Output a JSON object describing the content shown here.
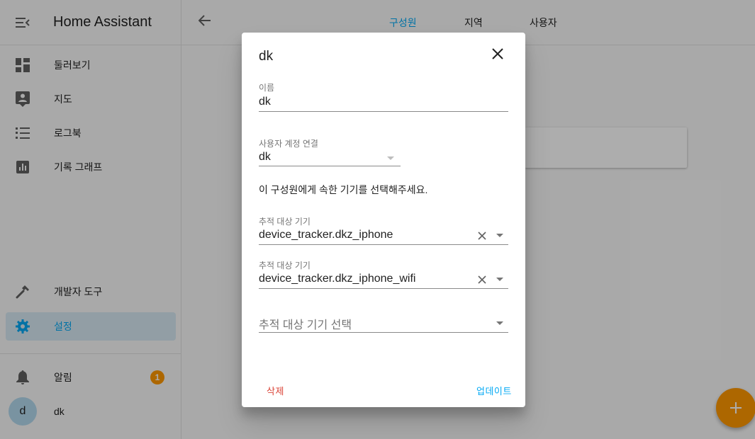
{
  "app": {
    "title": "Home Assistant"
  },
  "sidebar": {
    "items": [
      {
        "label": "둘러보기",
        "icon": "dashboard-icon"
      },
      {
        "label": "지도",
        "icon": "map-account-icon"
      },
      {
        "label": "로그북",
        "icon": "format-list-icon"
      },
      {
        "label": "기록 그래프",
        "icon": "chart-box-icon"
      },
      {
        "label": "개발자 도구",
        "icon": "hammer-icon"
      },
      {
        "label": "설정",
        "icon": "cog-icon",
        "active": true
      }
    ],
    "notifications": {
      "label": "알림",
      "count": "1"
    },
    "user": {
      "avatar_letter": "d",
      "name": "dk"
    }
  },
  "topbar": {
    "tabs": [
      {
        "label": "구성원",
        "active": true
      },
      {
        "label": "지역"
      },
      {
        "label": "사용자"
      }
    ]
  },
  "dialog": {
    "title": "dk",
    "name_field": {
      "label": "이름",
      "value": "dk"
    },
    "user_field": {
      "label": "사용자 계정 연결",
      "value": "dk"
    },
    "hint": "이 구성원에게 속한 기기를 선택해주세요.",
    "tracker_1": {
      "label": "추적 대상 기기",
      "value": "device_tracker.dkz_iphone"
    },
    "tracker_2": {
      "label": "추적 대상 기기",
      "value": "device_tracker.dkz_iphone_wifi"
    },
    "tracker_new": {
      "placeholder": "추적 대상 기기 선택"
    },
    "delete_label": "삭제",
    "update_label": "업데이트"
  },
  "colors": {
    "accent": "#03a9f4",
    "fab": "#ff9800",
    "delete": "#db4437",
    "badge": "#ff9800"
  }
}
